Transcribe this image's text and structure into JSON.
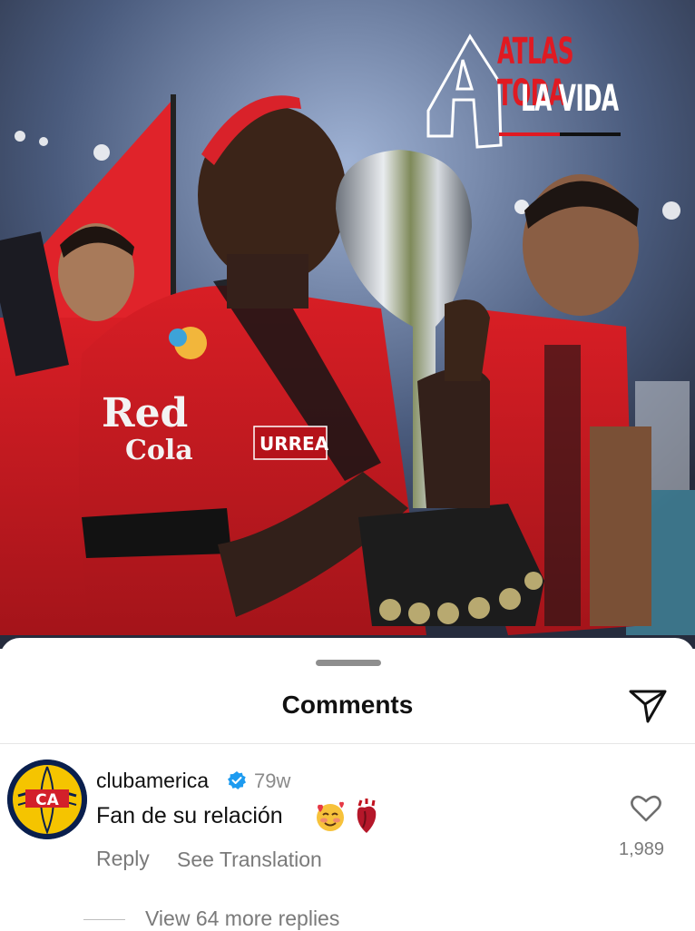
{
  "photo": {
    "logo": {
      "line1": "ATLAS TODA",
      "line2": "LA VIDA",
      "letter": "A"
    },
    "jersey_texts": [
      "Red",
      "Cola",
      "URREA"
    ],
    "colors": {
      "jersey_red": "#c8181f",
      "jersey_black": "#141414",
      "trophy_silver": "#c9ccd1",
      "flag_red": "#e0232a"
    }
  },
  "sheet": {
    "title": "Comments",
    "share_icon": "paper-plane-icon"
  },
  "comment": {
    "username": "clubamerica",
    "verified": true,
    "time": "79w",
    "text": "Fan de su relación",
    "emojis": [
      "smiling-face-with-hearts",
      "anatomical-heart"
    ],
    "avatar_letters": "CA",
    "reply_label": "Reply",
    "translate_label": "See Translation",
    "like_icon": "heart-outline-icon",
    "like_count": "1,989",
    "view_replies": "View 64 more replies"
  },
  "colors": {
    "text_primary": "#111111",
    "text_secondary": "#7a7a7a",
    "verified_blue": "#1d9bf0",
    "america_navy": "#0a1f4d",
    "america_yellow": "#f5c400"
  }
}
